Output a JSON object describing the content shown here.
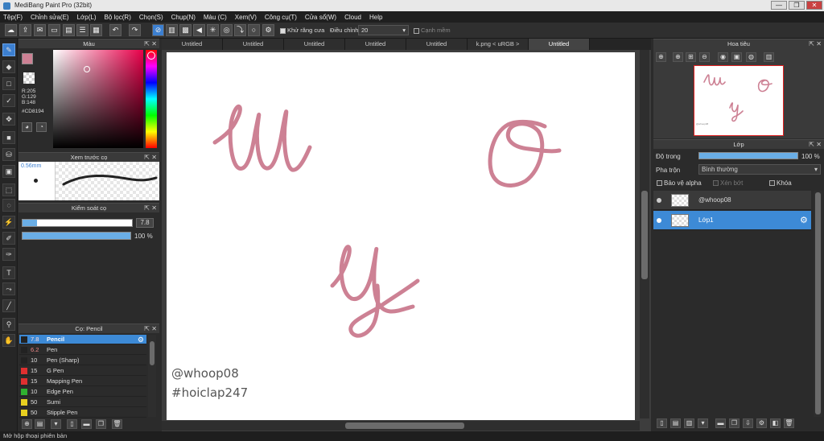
{
  "window": {
    "title": "MediBang Paint Pro (32bit)",
    "minimize": "—",
    "restore": "❐",
    "close": "✕"
  },
  "menu": [
    "Tệp(F)",
    "Chỉnh sửa(E)",
    "Lớp(L)",
    "Bộ lọc(R)",
    "Chọn(S)",
    "Chụp(N)",
    "Màu (C)",
    "Xem(V)",
    "Công cụ(T)",
    "Cửa sổ(W)",
    "Cloud",
    "Help"
  ],
  "toolbar": {
    "antialias_label": "Khử răng cưa",
    "adjust_label": "Điều chỉnh",
    "adjust_value": "20",
    "smooth_label": "Cạnh mềm"
  },
  "color_panel": {
    "title": "Màu",
    "r": "R:205",
    "g": "G:129",
    "b": "B:148",
    "hex": "#CD8194",
    "primary_color": "#CD8194",
    "secondary_color": "#1e1e1e"
  },
  "brush_preview": {
    "title": "Xem trước cọ",
    "size": "0.56mm"
  },
  "brush_control": {
    "title": "Kiểm soát cọ",
    "size_value": "7.8",
    "opacity_value": "100 %"
  },
  "brush_panel": {
    "title": "Cọ: Pencil",
    "items": [
      {
        "size": "7.8",
        "name": "Pencil",
        "color": "#222222",
        "selected": true
      },
      {
        "size": "6.2",
        "name": "Pen",
        "color": "#222222"
      },
      {
        "size": "10",
        "name": "Pen (Sharp)",
        "color": "#222222"
      },
      {
        "size": "15",
        "name": "G Pen",
        "color": "#e03030"
      },
      {
        "size": "15",
        "name": "Mapping Pen",
        "color": "#e03030"
      },
      {
        "size": "10",
        "name": "Edge Pen",
        "color": "#30b030"
      },
      {
        "size": "50",
        "name": "Sumi",
        "color": "#e8d020"
      },
      {
        "size": "50",
        "name": "Stipple Pen",
        "color": "#e8d020"
      }
    ]
  },
  "tabs": [
    "Untitled",
    "Untitled",
    "Untitled",
    "Untitled",
    "Untitled",
    "k.png < uRGB >",
    "Untitled"
  ],
  "canvas": {
    "signature_line1": "@whoop08",
    "signature_line2": "#hoiclap247",
    "stroke_color": "#cd8194"
  },
  "navigator": {
    "title": "Hoa tiêu",
    "preview_caption": "@whoop08"
  },
  "layer_panel": {
    "title": "Lớp",
    "opacity_label": "Độ trong",
    "opacity_value": "100 %",
    "blend_label": "Pha trộn",
    "blend_value": "Bình thường",
    "protect_alpha": "Bảo vệ alpha",
    "clipping": "Xén bớt",
    "lock": "Khóa",
    "layers": [
      {
        "name": "@whoop08",
        "selected": false
      },
      {
        "name": "Lớp1",
        "selected": true
      }
    ]
  },
  "status": {
    "text": "Mở hộp thoại phiên bản"
  }
}
